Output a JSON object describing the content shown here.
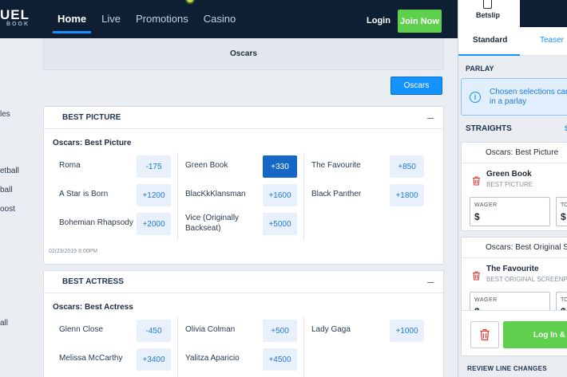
{
  "header": {
    "logo_big": "UEL",
    "logo_small": "BOOK",
    "nav": [
      "Home",
      "Live",
      "Promotions",
      "Casino"
    ],
    "login": "Login",
    "join": "Join Now"
  },
  "sidebar": {
    "items": [
      "les",
      "etball",
      "ball",
      "oost",
      "all"
    ]
  },
  "event_tab": "Oscars",
  "filter_button": "Oscars",
  "best_picture": {
    "header": "BEST PICTURE",
    "market": "Oscars: Best Picture",
    "outcomes": [
      {
        "name": "Roma",
        "odds": "-175"
      },
      {
        "name": "A Star is Born",
        "odds": "+1200"
      },
      {
        "name": "Bohemian Rhapsody",
        "odds": "+2000"
      },
      {
        "name": "Green Book",
        "odds": "+330"
      },
      {
        "name": "BlacKkKlansman",
        "odds": "+1600"
      },
      {
        "name": "Vice (Originally Backseat)",
        "odds": "+5000"
      },
      {
        "name": "The Favourite",
        "odds": "+850"
      },
      {
        "name": "Black Panther",
        "odds": "+1800"
      }
    ],
    "timestamp": "02/23/2019 8:00PM"
  },
  "best_actress": {
    "header": "BEST ACTRESS",
    "market": "Oscars: Best Actress",
    "outcomes": [
      {
        "name": "Glenn Close",
        "odds": "-450"
      },
      {
        "name": "Melissa McCarthy",
        "odds": "+3400"
      },
      {
        "name": "Olivia Colman",
        "odds": "+500"
      },
      {
        "name": "Yalitza Aparicio",
        "odds": "+4500"
      },
      {
        "name": "Lady Gaga",
        "odds": "+1000"
      }
    ]
  },
  "betslip": {
    "tab": "Betslip",
    "standard": "Standard",
    "teaser": "Teaser",
    "parlay": "PARLAY",
    "info_line1": "Chosen selections can",
    "info_line2": "in a parlay",
    "straights": "STRAIGHTS",
    "straights_link": "S",
    "bets": [
      {
        "title": "Oscars: Best Picture",
        "selection": "Green Book",
        "market": "BEST PICTURE"
      },
      {
        "title": "Oscars: Best Original Sc",
        "selection": "The Favourite",
        "market": "BEST ORIGINAL SCREENPL"
      }
    ],
    "wager_label": "WAGER",
    "to_label": "TO",
    "currency": "$",
    "login_place": "Log In & P",
    "review": "REVIEW LINE CHANGES"
  }
}
